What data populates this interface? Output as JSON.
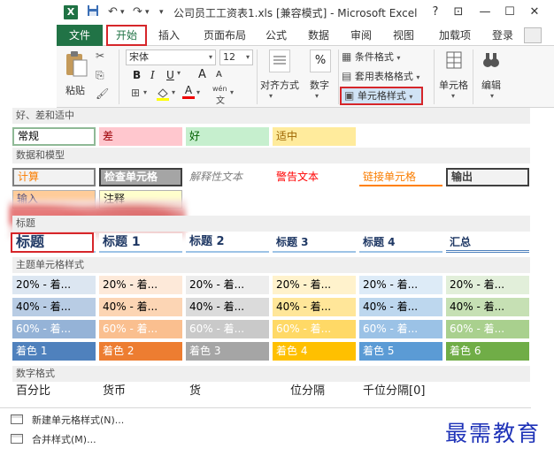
{
  "window": {
    "app_icon": "X",
    "title": "公司员工工资表1.xls  [兼容模式] - Microsoft Excel",
    "help": "?",
    "controls": {
      "restore_ribbon": "⊡",
      "minimize": "—",
      "maximize": "☐",
      "close": "✕"
    }
  },
  "quick_access": {
    "save": "💾",
    "undo": "↶",
    "redo": "↷",
    "customize": "▾"
  },
  "tabs": [
    "文件",
    "开始",
    "插入",
    "页面布局",
    "公式",
    "数据",
    "审阅",
    "视图",
    "加载项",
    "登录"
  ],
  "ribbon": {
    "paste_label": "粘贴",
    "font_name": "宋体",
    "font_size": "12",
    "bold": "B",
    "italic": "I",
    "underline": "U",
    "grow_font": "A",
    "shrink_font": "A",
    "wen": "wén",
    "alignment_label": "对齐方式",
    "number_label": "数字",
    "percent": "%",
    "conditional_format": "条件格式",
    "format_as_table": "套用表格格式",
    "cell_styles": "单元格样式",
    "cells_label": "单元格",
    "editing_label": "编辑"
  },
  "gallery": {
    "sections": {
      "good_bad": "好、差和适中",
      "data_model": "数据和模型",
      "titles": "标题",
      "themed": "主题单元格样式",
      "number": "数字格式"
    },
    "good_bad_styles": [
      {
        "label": "常规",
        "bg": "#ffffff",
        "fg": "#000000",
        "border": "#8fb996"
      },
      {
        "label": "差",
        "bg": "#ffc7ce",
        "fg": "#9c0006"
      },
      {
        "label": "好",
        "bg": "#c6efce",
        "fg": "#006100"
      },
      {
        "label": "适中",
        "bg": "#ffeb9c",
        "fg": "#9c6500"
      }
    ],
    "data_model_row1": [
      {
        "label": "计算",
        "bg": "#f2f2f2",
        "fg": "#fa7d00",
        "border": "#7f7f7f"
      },
      {
        "label": "检查单元格",
        "bg": "#a5a5a5",
        "fg": "#ffffff",
        "border": "#3f3f3f"
      },
      {
        "label": "解释性文本",
        "bg": "#ffffff",
        "fg": "#7f7f7f"
      },
      {
        "label": "警告文本",
        "bg": "#ffffff",
        "fg": "#ff0000"
      },
      {
        "label": "链接单元格",
        "bg": "#ffffff",
        "fg": "#fa7d00"
      },
      {
        "label": "输出",
        "bg": "#f2f2f2",
        "fg": "#3f3f3f",
        "border": "#3f3f3f"
      }
    ],
    "data_model_row2": [
      {
        "label": "输入",
        "bg": "#ffcc99",
        "fg": "#3f3f76"
      },
      {
        "label": "注释",
        "bg": "#ffffcc",
        "fg": "#000000"
      }
    ],
    "title_styles": [
      {
        "label": "标题",
        "size": "16px"
      },
      {
        "label": "标题 1",
        "size": "14px"
      },
      {
        "label": "标题 2",
        "size": "13px"
      },
      {
        "label": "标题 3",
        "size": "12px"
      },
      {
        "label": "标题 4",
        "size": "12px"
      },
      {
        "label": "汇总",
        "size": "12px"
      }
    ],
    "accent_20": [
      "20% - 着...",
      "20% - 着...",
      "20% - 着...",
      "20% - 着...",
      "20% - 着...",
      "20% - 着..."
    ],
    "accent_40": [
      "40% - 着...",
      "40% - 着...",
      "40% - 着...",
      "40% - 着...",
      "40% - 着...",
      "40% - 着..."
    ],
    "accent_60": [
      "60% - 着...",
      "60% - 着...",
      "60% - 着...",
      "60% - 着...",
      "60% - 着...",
      "60% - 着..."
    ],
    "accent_full": [
      "着色 1",
      "着色 2",
      "着色 3",
      "着色 4",
      "着色 5",
      "着色 6"
    ],
    "accent_colors": {
      "c20": [
        "#dce6f1",
        "#fde9d9",
        "#ededed",
        "#fff2cc",
        "#ddebf7",
        "#e2efda"
      ],
      "c40": [
        "#b8cce4",
        "#fcd5b4",
        "#dbdbdb",
        "#ffe699",
        "#bdd7ee",
        "#c6e0b4"
      ],
      "c60": [
        "#95b3d7",
        "#fabf8f",
        "#c9c9c9",
        "#ffd966",
        "#9bc2e6",
        "#a9d08e"
      ],
      "c100": [
        "#4f81bd",
        "#ed7d31",
        "#a5a5a5",
        "#ffc000",
        "#5b9bd5",
        "#70ad47"
      ],
      "c60_text": "#ffffff",
      "c100_text": "#ffffff"
    },
    "number_styles": [
      "百分比",
      "货币",
      "货",
      "位分隔",
      "千位分隔[0]"
    ]
  },
  "menu": {
    "new_style": "新建单元格样式(N)...",
    "merge_styles": "合并样式(M)..."
  },
  "watermark": "最需教育"
}
